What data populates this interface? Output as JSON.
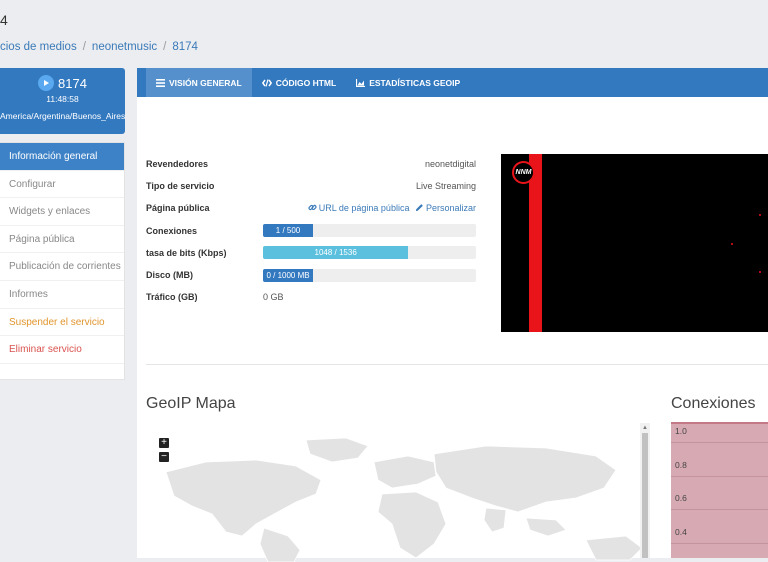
{
  "page": {
    "title_fragment": "4"
  },
  "breadcrumb": {
    "items": [
      "cios de medios",
      "neonetmusic",
      "8174"
    ]
  },
  "service": {
    "id": "8174",
    "time": "11:48:58",
    "timezone": "America/Argentina/Buenos_Aires"
  },
  "sidebar": {
    "items": [
      {
        "label": "Información general",
        "state": "active"
      },
      {
        "label": "Configurar",
        "state": "normal"
      },
      {
        "label": "Widgets y enlaces",
        "state": "normal"
      },
      {
        "label": "Página pública",
        "state": "normal"
      },
      {
        "label": "Publicación de corrientes",
        "state": "normal"
      },
      {
        "label": "Informes",
        "state": "normal"
      },
      {
        "label": "Suspender el servicio",
        "state": "warning"
      },
      {
        "label": "Eliminar servicio",
        "state": "danger"
      }
    ]
  },
  "tabs": [
    {
      "label": "VISIÓN GENERAL",
      "icon": "list-icon",
      "active": true
    },
    {
      "label": "CÓDIGO HTML",
      "icon": "code-icon",
      "active": false
    },
    {
      "label": "ESTADÍSTICAS GEOIP",
      "icon": "area-chart-icon",
      "active": false
    }
  ],
  "info": {
    "reseller_label": "Revendedores",
    "reseller_value": "neonetdigital",
    "service_type_label": "Tipo de servicio",
    "service_type_value": "Live Streaming",
    "public_page_label": "Página pública",
    "public_url_link": "URL de página pública",
    "customize_link": "Personalizar",
    "connections_label": "Conexiones",
    "connections_text": "1 / 500",
    "connections_fill": 0.235,
    "bitrate_label": "tasa de bits (Kbps)",
    "bitrate_text": "1048 / 1536",
    "bitrate_fill": 0.682,
    "disk_label": "Disco (MB)",
    "disk_text": "0 / 1000 MB",
    "disk_fill": 0.235,
    "traffic_label": "Tráfico (GB)",
    "traffic_value": "0 GB"
  },
  "video": {
    "logo_text": "NNM"
  },
  "geoip": {
    "title": "GeoIP Mapa",
    "zoom_in": "+",
    "zoom_out": "−"
  },
  "connections_chart": {
    "title": "Conexiones",
    "chart_data": {
      "type": "area",
      "title": "Conexiones",
      "yticks": [
        "1.0",
        "0.8",
        "0.6",
        "0.4"
      ],
      "ylim": [
        0.4,
        1.0
      ],
      "colors": {
        "fill": "#d7aab3",
        "line": "#c47a86"
      }
    }
  },
  "colors": {
    "primary": "#3379c0",
    "accent_cyan": "#5bc0de",
    "warning": "#e0952d",
    "danger": "#d9534f",
    "stream_red": "#e8141a"
  }
}
